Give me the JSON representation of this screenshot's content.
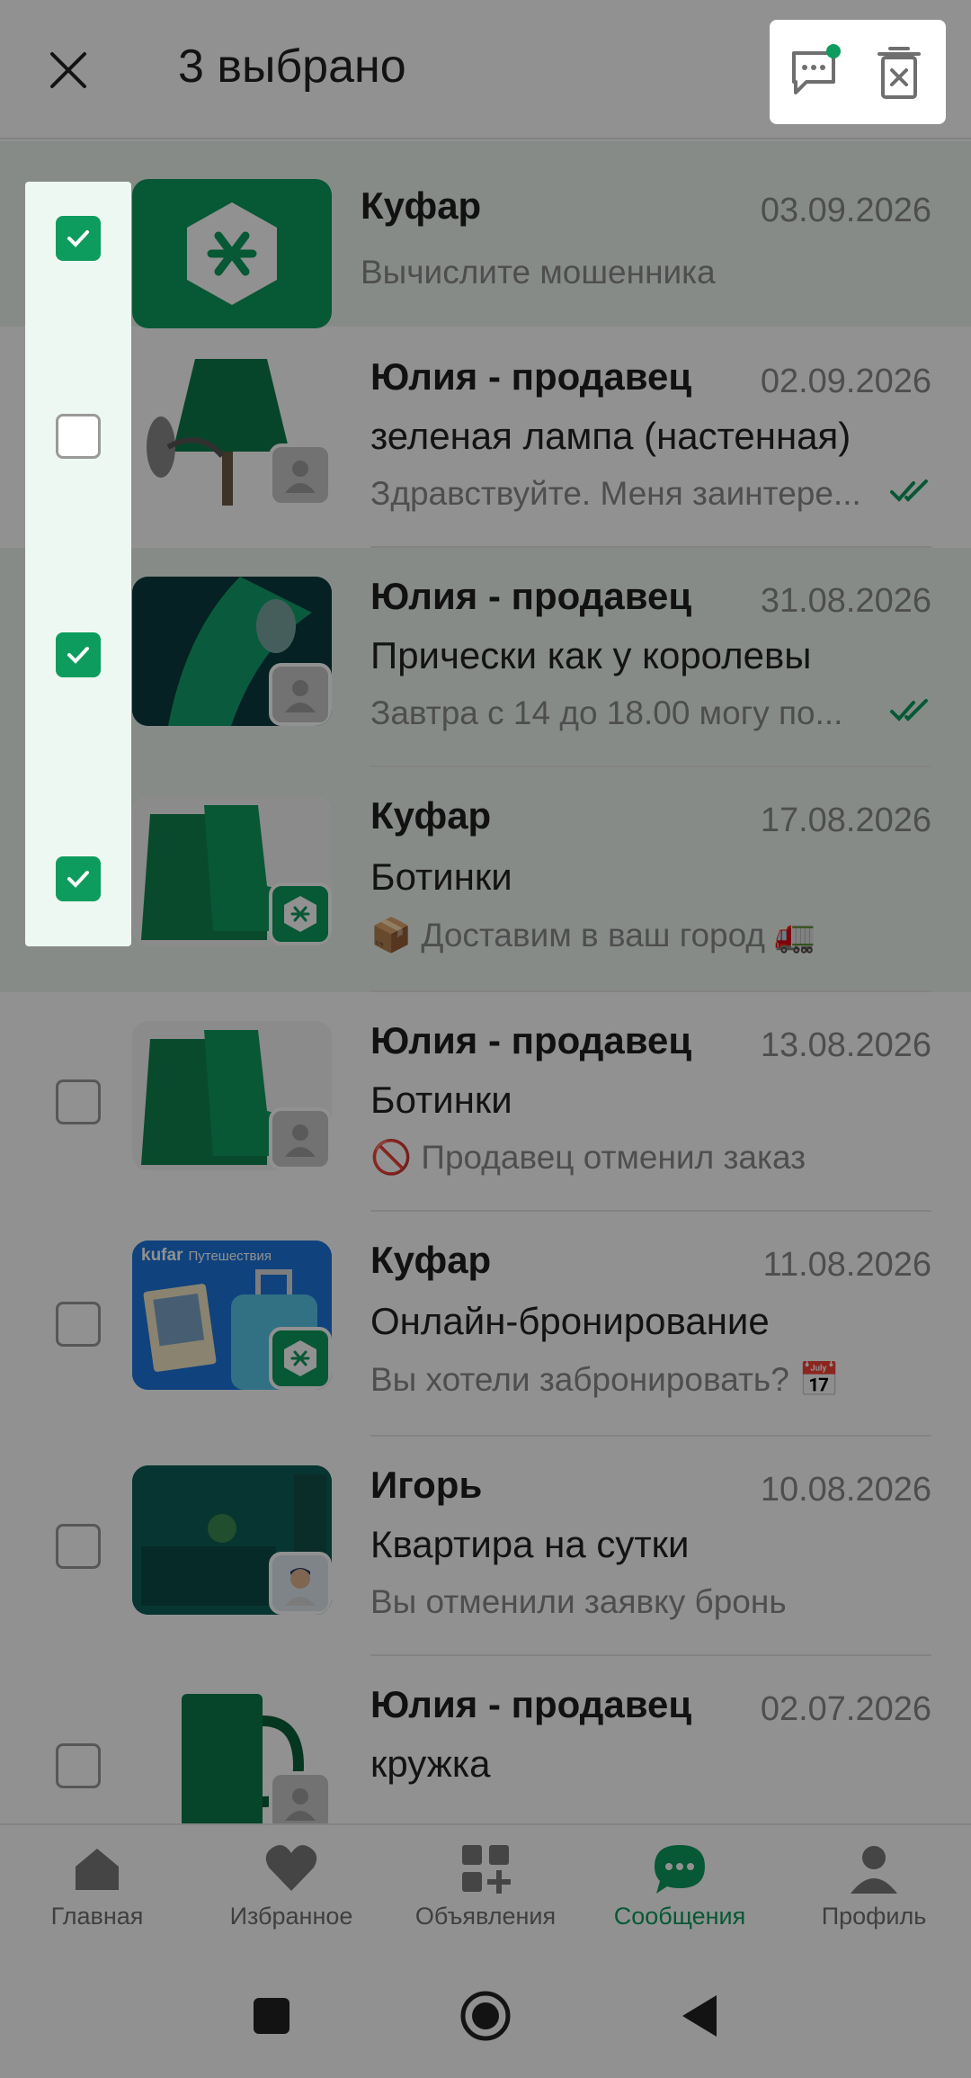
{
  "header": {
    "title": "3 выбрано",
    "close_icon": "close-icon",
    "new_chat_icon": "message-dots-icon",
    "delete_icon": "delete-trash-icon"
  },
  "colors": {
    "accent": "#0d9c5e",
    "muted": "#8a8a8a"
  },
  "chats": [
    {
      "sender": "Куфар",
      "date": "03.09.2026",
      "subject": "",
      "preview": "Вычислите мошенника",
      "selected": true,
      "thumb": "kufar-logo",
      "badge": "",
      "read": false
    },
    {
      "sender": "Юлия - продавец",
      "date": "02.09.2026",
      "subject": "зеленая лампа (настенная)",
      "preview": "Здравствуйте. Меня заинтере...",
      "selected": false,
      "thumb": "lamp",
      "badge": "user",
      "read": true
    },
    {
      "sender": "Юлия - продавец",
      "date": "31.08.2026",
      "subject": "Прически как у королевы",
      "preview": "Завтра  с 14 до 18.00 могу по...",
      "selected": true,
      "thumb": "hair",
      "badge": "user",
      "read": true
    },
    {
      "sender": "Куфар",
      "date": "17.08.2026",
      "subject": "Ботинки",
      "preview": "📦 Доставим в ваш город 🚛",
      "selected": true,
      "thumb": "boots",
      "badge": "kufar",
      "read": false
    },
    {
      "sender": "Юлия - продавец",
      "date": "13.08.2026",
      "subject": "Ботинки",
      "preview": "🚫 Продавец отменил заказ",
      "selected": false,
      "thumb": "boots",
      "badge": "user",
      "read": false
    },
    {
      "sender": "Куфар",
      "date": "11.08.2026",
      "subject": "Онлайн-бронирование",
      "preview": "Вы хотели забронировать? 📅",
      "selected": false,
      "thumb": "travel",
      "badge": "kufar",
      "read": false
    },
    {
      "sender": "Игорь",
      "date": "10.08.2026",
      "subject": "Квартира на сутки",
      "preview": "Вы отменили заявку бронь",
      "selected": false,
      "thumb": "room",
      "badge": "photo",
      "read": false
    },
    {
      "sender": "Юлия - продавец",
      "date": "02.07.2026",
      "subject": "кружка",
      "preview": "",
      "selected": false,
      "thumb": "mug",
      "badge": "user",
      "read": false
    }
  ],
  "travel_thumb": {
    "brand": "kufar",
    "tag": "Путешествия"
  },
  "bottom_nav": [
    {
      "label": "Главная",
      "icon": "home-icon",
      "active": false
    },
    {
      "label": "Избранное",
      "icon": "heart-icon",
      "active": false
    },
    {
      "label": "Объявления",
      "icon": "ads-grid-icon",
      "active": false
    },
    {
      "label": "Сообщения",
      "icon": "chat-icon",
      "active": true
    },
    {
      "label": "Профиль",
      "icon": "profile-icon",
      "active": false
    }
  ],
  "system_nav": [
    "square-icon",
    "home-circle-icon",
    "back-triangle-icon"
  ]
}
